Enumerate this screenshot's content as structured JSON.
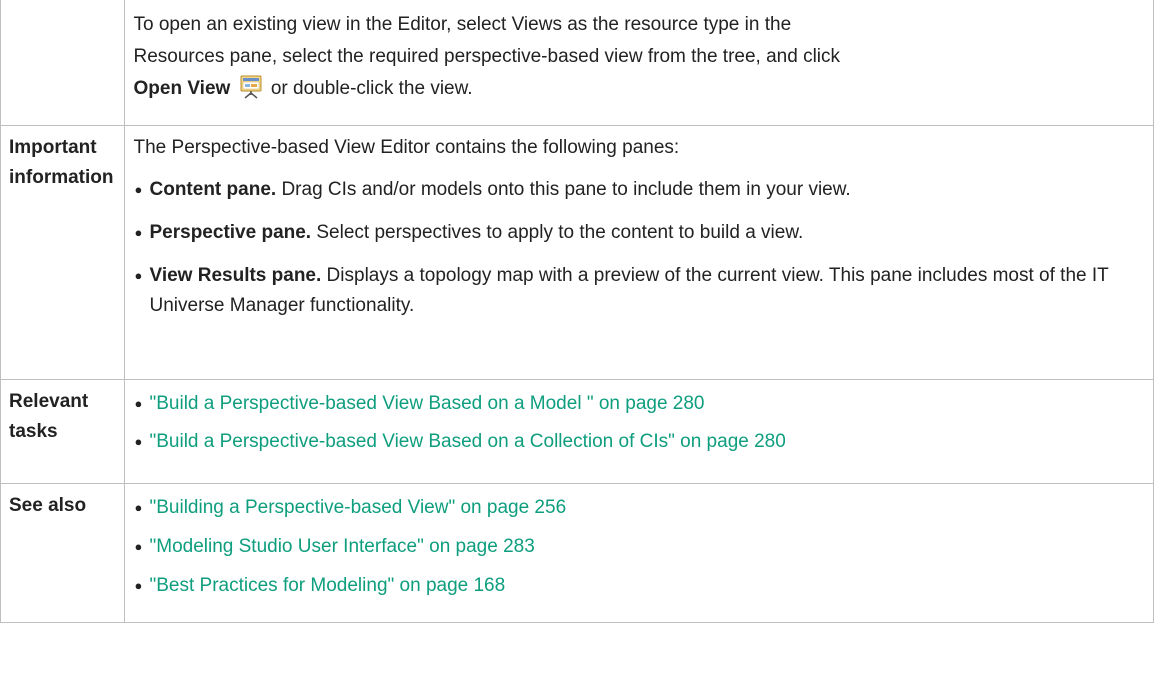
{
  "intro": {
    "line1": "To open an existing view in the Editor, select Views as the resource type in the",
    "line2": "Resources pane, select the required perspective-based view from the tree, and click",
    "open_view_label": "Open View",
    "open_view_icon": "open-view-icon",
    "line3_tail": "or double-click the view."
  },
  "important": {
    "label_line1": "Important",
    "label_line2": "information",
    "lead": "The Perspective-based View Editor contains the following panes:",
    "items": [
      {
        "term": "Content pane.",
        "text": " Drag CIs and/or models onto this pane to include them in your view."
      },
      {
        "term": "Perspective pane.",
        "text": " Select perspectives to apply to the content to build a view."
      },
      {
        "term": "View Results pane.",
        "text": " Displays a topology map with a preview of the current view. This pane includes most of the IT Universe Manager functionality."
      }
    ]
  },
  "relevant": {
    "label_line1": "Relevant",
    "label_line2": "tasks",
    "links": [
      "\"Build a Perspective-based View Based on a Model \" on page 280",
      "\"Build a Perspective-based View Based on a Collection of CIs\" on page 280"
    ]
  },
  "see_also": {
    "label": "See also",
    "links": [
      "\"Building a Perspective-based View\" on page 256",
      "\"Modeling Studio User Interface\" on page 283",
      "\"Best Practices for Modeling\" on page 168"
    ]
  },
  "colors": {
    "link": "#0e9e7e",
    "border": "#bfbfbf",
    "text": "#222222"
  }
}
